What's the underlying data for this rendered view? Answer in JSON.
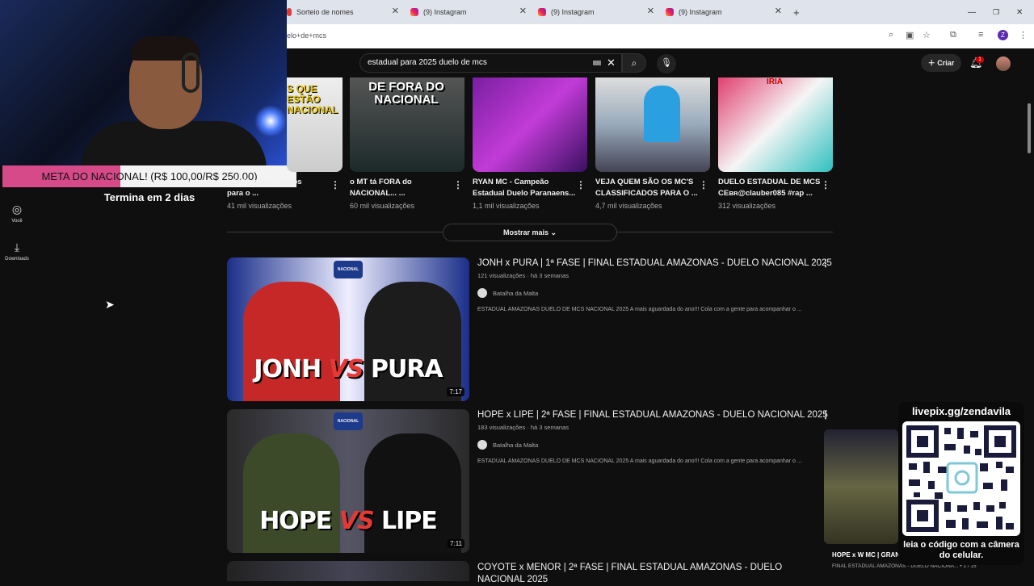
{
  "browser": {
    "tabs": [
      {
        "label": "Sorteio de nomes"
      },
      {
        "label": "(9) Instagram"
      },
      {
        "label": "(9) Instagram"
      },
      {
        "label": "(9) Instagram"
      }
    ],
    "address": "elo+de+mcs"
  },
  "stream": {
    "goal_text": "META DO NACIONAL! (R$ 100,00/R$ 250,00)",
    "goal_sub": "Termina em 2 dias",
    "goal_progress": 0.4,
    "qr_url": "livepix.gg/zendavila",
    "qr_caption": "leia o código com a câmera do celular."
  },
  "youtube": {
    "search": "estadual para 2025 duelo de mcs",
    "create_label": "Criar",
    "notif_count": "1",
    "sidebar": [
      {
        "label": "Você",
        "icon": "user-circle-icon"
      },
      {
        "label": "Downloads",
        "icon": "download-icon"
      }
    ],
    "shorts": [
      {
        "title": "...MC's classificados para o ...",
        "views": "41 mil visualizações",
        "overlay": "S QUE ESTÃO NACIONAL"
      },
      {
        "title": "o MT tá FORA do NACIONAL... ...",
        "views": "60 mil visualizações",
        "overlay": "DE FORA DO NACIONAL"
      },
      {
        "title": "RYAN MC - Campeão Estadual Duelo Paranaens...",
        "views": "1,1 mil visualizações",
        "overlay": ""
      },
      {
        "title": "VEJA QUEM SÃO OS MC'S CLASSIFICADOS PARA O ...",
        "views": "4,7 mil visualizações",
        "overlay": ""
      },
      {
        "title": "DUELO ESTADUAL DE MCS CEʙʀ@clauber085 #rap ...",
        "views": "312 visualizações",
        "overlay": "IRIA"
      }
    ],
    "show_more": "Mostrar mais",
    "videos": [
      {
        "title": "JONH x PURA | 1ª FASE | FINAL ESTADUAL AMAZONAS - DUELO NACIONAL 2025",
        "meta": "121 visualizações  ·  há 3 semanas",
        "channel": "Batalha da Malta",
        "desc": "ESTADUAL AMAZONAS DUELO DE MCS NACIONAL 2025 A mais aguardada do ano!!! Cola com a gente para acompanhar o ...",
        "duration": "7:17",
        "left": "JONH",
        "right": "PURA"
      },
      {
        "title": "HOPE x LIPE | 2ª FASE | FINAL ESTADUAL AMAZONAS - DUELO NACIONAL 2025",
        "meta": "183 visualizações  ·  há 3 semanas",
        "channel": "Batalha da Malta",
        "desc": "ESTADUAL AMAZONAS DUELO DE MCS NACIONAL 2025 A mais aguardada do ano!!! Cola com a gente para acompanhar o ...",
        "duration": "7:11",
        "left": "HOPE",
        "right": "LIPE"
      },
      {
        "title": "COYOTE x MENOR | 2ª FASE | FINAL ESTADUAL AMAZONAS - DUELO NACIONAL 2025",
        "meta": "",
        "channel": "",
        "desc": "",
        "duration": "",
        "left": "",
        "right": ""
      }
    ],
    "vs": "VS",
    "logo_text": "NACIONAL",
    "mini_player": {
      "title": "HOPE x W MC | GRAN",
      "sub": "FINAL ESTADUAL AMAZONAS - DUELO NACIONA... • 1 / 15"
    }
  }
}
